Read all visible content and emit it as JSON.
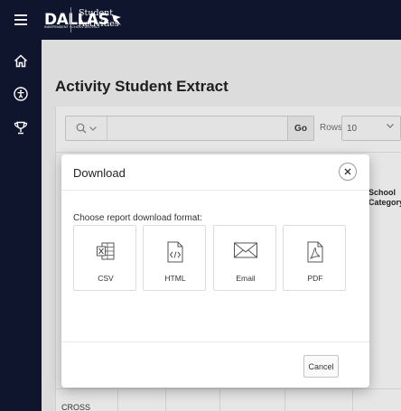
{
  "header": {
    "brand_name": "DALLAS",
    "brand_tagline": "INDEPENDENT SCHOOL DISTRICT",
    "app_name_line1": "Student",
    "app_name_line2": "Activities"
  },
  "nav": {
    "icons": [
      "menu-icon",
      "home-icon",
      "accessibility-icon",
      "trophy-icon"
    ]
  },
  "page": {
    "title": "Activity Student Extract",
    "toolbar": {
      "go_label": "Go",
      "rows_label": "Rows",
      "rows_value": "10"
    },
    "column_header_line1": "School",
    "column_header_line2": "Category",
    "first_cell": "CROSS"
  },
  "modal": {
    "title": "Download",
    "prompt": "Choose report download format:",
    "formats": [
      {
        "label": "CSV",
        "icon": "csv-file-icon"
      },
      {
        "label": "HTML",
        "icon": "html-file-icon"
      },
      {
        "label": "Email",
        "icon": "email-icon"
      },
      {
        "label": "PDF",
        "icon": "pdf-file-icon"
      }
    ],
    "cancel_label": "Cancel"
  },
  "colors": {
    "header_bg": "#10152e",
    "backdrop": "#dcdcdc",
    "modal_bg": "#ffffff"
  }
}
